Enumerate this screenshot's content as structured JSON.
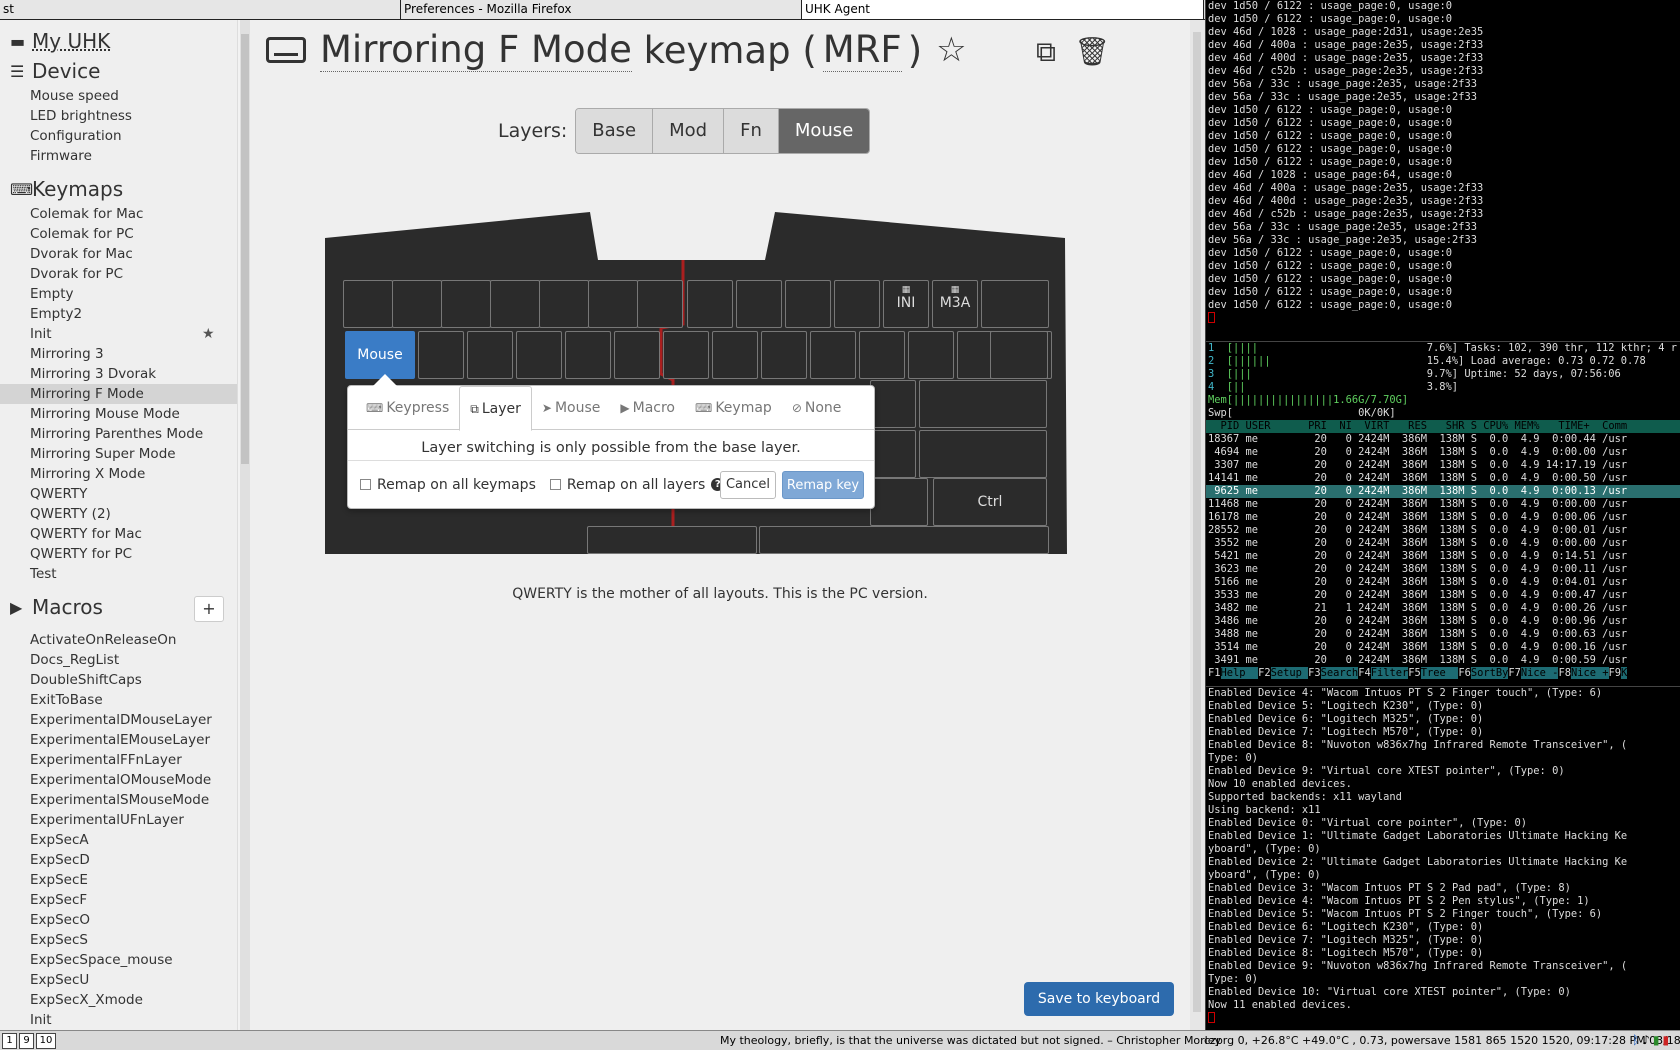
{
  "titlebar": {
    "t1": "st",
    "t2": "Preferences - Mozilla Firefox",
    "t3": "UHK Agent"
  },
  "sidebar": {
    "my_uhk": "My UHK",
    "device_header": "Device",
    "device_items": [
      "Mouse speed",
      "LED brightness",
      "Configuration",
      "Firmware"
    ],
    "keymaps_header": "Keymaps",
    "keymaps": [
      "Colemak for Mac",
      "Colemak for PC",
      "Dvorak for Mac",
      "Dvorak for PC",
      "Empty",
      "Empty2",
      "Init",
      "Mirroring 3",
      "Mirroring 3 Dvorak",
      "Mirroring F Mode",
      "Mirroring Mouse Mode",
      "Mirroring Parenthes Mode",
      "Mirroring Super Mode",
      "Mirroring X Mode",
      "QWERTY",
      "QWERTY (2)",
      "QWERTY for Mac",
      "QWERTY for PC",
      "Test"
    ],
    "selected_keymap": "Mirroring F Mode",
    "starred_keymap": "Init",
    "macros_header": "Macros",
    "macros_add": "+",
    "macros": [
      "ActivateOnReleaseOn",
      "Docs_RegList",
      "DoubleShiftCaps",
      "ExitToBase",
      "ExperimentalDMouseLayer",
      "ExperimentalEMouseLayer",
      "ExperimentalFFnLayer",
      "ExperimentalOMouseMode",
      "ExperimentalSMouseMode",
      "ExperimentalUFnLayer",
      "ExpSecA",
      "ExpSecD",
      "ExpSecE",
      "ExpSecF",
      "ExpSecO",
      "ExpSecS",
      "ExpSecSpace_mouse",
      "ExpSecU",
      "ExpSecX_Xmode",
      "Init"
    ]
  },
  "main": {
    "title_name": "Mirroring F Mode",
    "title_word": "keymap (",
    "title_abbr": "MRF",
    "title_close": ")",
    "layers_label": "Layers:",
    "layers": [
      "Base",
      "Mod",
      "Fn",
      "Mouse"
    ],
    "active_layer": "Mouse",
    "keys": {
      "ini": "INI",
      "m3a": "M3A",
      "mouse": "Mouse",
      "ctrl": "Ctrl"
    },
    "popover": {
      "tabs": [
        "Keypress",
        "Layer",
        "Mouse",
        "Macro",
        "Keymap",
        "None"
      ],
      "active_tab": "Layer",
      "message": "Layer switching is only possible from the base layer.",
      "remap_all_keymaps": "Remap on all keymaps",
      "remap_all_layers": "Remap on all layers",
      "help": "?",
      "cancel": "Cancel",
      "remap": "Remap key"
    },
    "description": "QWERTY is the mother of all layouts. This is the PC version.",
    "save": "Save to keyboard"
  },
  "terminal1": [
    "dev 1d50 / 6122 : usage_page:0, usage:0",
    "dev 1d50 / 6122 : usage_page:0, usage:0",
    "dev 46d / 1028 : usage_page:2d31, usage:2e35",
    "dev 46d / 400a : usage_page:2e35, usage:2f33",
    "dev 46d / 400d : usage_page:2e35, usage:2f33",
    "dev 46d / c52b : usage_page:2e35, usage:2f33",
    "dev 56a / 33c : usage_page:2e35, usage:2f33",
    "dev 56a / 33c : usage_page:2e35, usage:2f33",
    "dev 1d50 / 6122 : usage_page:0, usage:0",
    "dev 1d50 / 6122 : usage_page:0, usage:0",
    "dev 1d50 / 6122 : usage_page:0, usage:0",
    "dev 1d50 / 6122 : usage_page:0, usage:0",
    "dev 1d50 / 6122 : usage_page:0, usage:0",
    "dev 46d / 1028 : usage_page:64, usage:0",
    "dev 46d / 400a : usage_page:2e35, usage:2f33",
    "dev 46d / 400d : usage_page:2e35, usage:2f33",
    "dev 46d / c52b : usage_page:2e35, usage:2f33",
    "dev 56a / 33c : usage_page:2e35, usage:2f33",
    "dev 56a / 33c : usage_page:2e35, usage:2f33",
    "dev 1d50 / 6122 : usage_page:0, usage:0",
    "dev 1d50 / 6122 : usage_page:0, usage:0",
    "dev 1d50 / 6122 : usage_page:0, usage:0",
    "dev 1d50 / 6122 : usage_page:0, usage:0",
    "dev 1d50 / 6122 : usage_page:0, usage:0"
  ],
  "htop": {
    "cpu": [
      {
        "n": "1",
        "bar": "[||||",
        "pct": "7.6%]"
      },
      {
        "n": "2",
        "bar": "[||||||",
        "pct": "15.4%]"
      },
      {
        "n": "3",
        "bar": "[|||",
        "pct": "9.7%]"
      },
      {
        "n": "4",
        "bar": "[||",
        "pct": "3.8%]"
      }
    ],
    "mem": "Mem[||||||||||||||||1.66G/7.70G]",
    "swp": "Swp[                    0K/0K]",
    "tasks": "Tasks: 102, 390 thr, 112 kthr; 4 r",
    "load": "Load average: 0.73 0.72 0.78",
    "uptime": "Uptime: 52 days, 07:56:06",
    "header": "  PID USER      PRI  NI  VIRT   RES   SHR S CPU% MEM%   TIME+  Comm",
    "rows": [
      "18367 me         20   0 2424M  386M  138M S  0.0  4.9  0:00.44 /usr",
      " 4694 me         20   0 2424M  386M  138M S  0.0  4.9  0:00.00 /usr",
      " 3307 me         20   0 2424M  386M  138M S  0.0  4.9 14:17.19 /usr",
      "14141 me         20   0 2424M  386M  138M S  0.0  4.9  0:00.50 /usr",
      " 9625 me         20   0 2424M  386M  138M S  0.0  4.9  0:00.13 /usr",
      "11468 me         20   0 2424M  386M  138M S  0.0  4.9  0:00.00 /usr",
      "16178 me         20   0 2424M  386M  138M S  0.0  4.9  0:00.06 /usr",
      "28552 me         20   0 2424M  386M  138M S  0.0  4.9  0:00.01 /usr",
      " 3552 me         20   0 2424M  386M  138M S  0.0  4.9  0:00.00 /usr",
      " 5421 me         20   0 2424M  386M  138M S  0.0  4.9  0:14.51 /usr",
      " 3623 me         20   0 2424M  386M  138M S  0.0  4.9  0:00.11 /usr",
      " 5166 me         20   0 2424M  386M  138M S  0.0  4.9  0:04.01 /usr",
      " 3533 me         20   0 2424M  386M  138M S  0.0  4.9  0:00.47 /usr",
      " 3482 me         21   1 2424M  386M  138M S  0.0  4.9  0:00.26 /usr",
      " 3486 me         20   0 2424M  386M  138M S  0.0  4.9  0:00.96 /usr",
      " 3488 me         20   0 2424M  386M  138M S  0.0  4.9  0:00.63 /usr",
      " 3514 me         20   0 2424M  386M  138M S  0.0  4.9  0:00.16 /usr",
      " 3491 me         20   0 2424M  386M  138M S  0.0  4.9  0:00.59 /usr"
    ],
    "selected_row": 4,
    "fkeys": [
      {
        "k": "F1",
        "l": "Help  "
      },
      {
        "k": "F2",
        "l": "Setup "
      },
      {
        "k": "F3",
        "l": "Search"
      },
      {
        "k": "F4",
        "l": "Filter"
      },
      {
        "k": "F5",
        "l": "Tree  "
      },
      {
        "k": "F6",
        "l": "SortBy"
      },
      {
        "k": "F7",
        "l": "Nice -"
      },
      {
        "k": "F8",
        "l": "Nice +"
      },
      {
        "k": "F9",
        "l": "K"
      }
    ]
  },
  "terminal3": [
    "Enabled Device 4: \"Wacom Intuos PT S 2 Finger touch\", (Type: 6)",
    "Enabled Device 5: \"Logitech K230\", (Type: 0)",
    "Enabled Device 6: \"Logitech M325\", (Type: 0)",
    "Enabled Device 7: \"Logitech M570\", (Type: 0)",
    "Enabled Device 8: \"Nuvoton w836x7hg Infrared Remote Transceiver\", (",
    "Type: 0)",
    "Enabled Device 9: \"Virtual core XTEST pointer\", (Type: 0)",
    "Now 10 enabled devices.",
    "Supported backends: x11 wayland",
    "Using backend: x11",
    "Enabled Device 0: \"Virtual core pointer\", (Type: 0)",
    "Enabled Device 1: \"Ultimate Gadget Laboratories Ultimate Hacking Ke",
    "yboard\", (Type: 0)",
    "Enabled Device 2: \"Ultimate Gadget Laboratories Ultimate Hacking Ke",
    "yboard\", (Type: 0)",
    "Enabled Device 3: \"Wacom Intuos PT S 2 Pad pad\", (Type: 8)",
    "Enabled Device 4: \"Wacom Intuos PT S 2 Pen stylus\", (Type: 1)",
    "Enabled Device 5: \"Wacom Intuos PT S 2 Finger touch\", (Type: 6)",
    "Enabled Device 6: \"Logitech K230\", (Type: 0)",
    "Enabled Device 7: \"Logitech M325\", (Type: 0)",
    "Enabled Device 8: \"Logitech M570\", (Type: 0)",
    "Enabled Device 9: \"Nuvoton w836x7hg Infrared Remote Transceiver\", (",
    "Type: 0)",
    "Enabled Device 10: \"Virtual core XTEST pointer\", (Type: 0)",
    "Now 11 enabled devices."
  ],
  "statusbar": {
    "workspaces": [
      "1",
      "9",
      "10"
    ],
    "quote": "My theology, briefly, is that the universe was dictated but not signed. – Christopher Morley",
    "sysinfo": "czprg 0,  +26.8°C +49.0°C , 0.73, powersave 1581 865 1520 1520, 09:17:28 PM 03/18/19"
  }
}
